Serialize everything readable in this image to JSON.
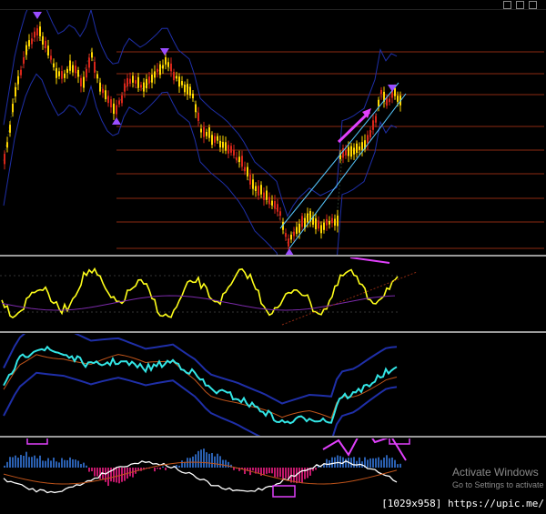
{
  "window": {
    "title_bar_buttons": [
      "minimize",
      "maximize",
      "close"
    ]
  },
  "watermark": {
    "title": "Activate Windows",
    "subtitle": "Go to Settings to activate"
  },
  "credit": "[1029x958] https://upic.me/",
  "colors": {
    "background": "#000000",
    "candle_up": "#ffd700",
    "candle_down": "#d9261a",
    "level_line": "#8b2a12",
    "arrow": "#9a4dff",
    "trend_line": "#56c8ff",
    "annotation": "#e040fb",
    "rsi": "#ffff1a",
    "osc_line": "#33e6e6",
    "hist_up": "#2a5fb0",
    "hist_down": "#c2186b",
    "band": "#1f2fa8",
    "separator": "#9a9a9a"
  },
  "chart_data": [
    {
      "type": "candlestick",
      "pane": "price",
      "trend": "downtrend then reversal uptrend",
      "horizontal_levels": 10,
      "markers": [
        "top-arrow",
        "high-arrow",
        "low-arrow",
        "recent-high-arrow"
      ],
      "annotations": [
        "magenta arrow up along rally",
        "cyan rising channel"
      ]
    },
    {
      "type": "line",
      "pane": "rsi-oscillator",
      "series_color": "yellow"
    },
    {
      "type": "line",
      "pane": "bands-oscillator",
      "series_color": "cyan"
    },
    {
      "type": "histogram",
      "pane": "macd-histogram",
      "annotations": [
        "magenta boxes",
        "magenta zigzag"
      ]
    }
  ]
}
